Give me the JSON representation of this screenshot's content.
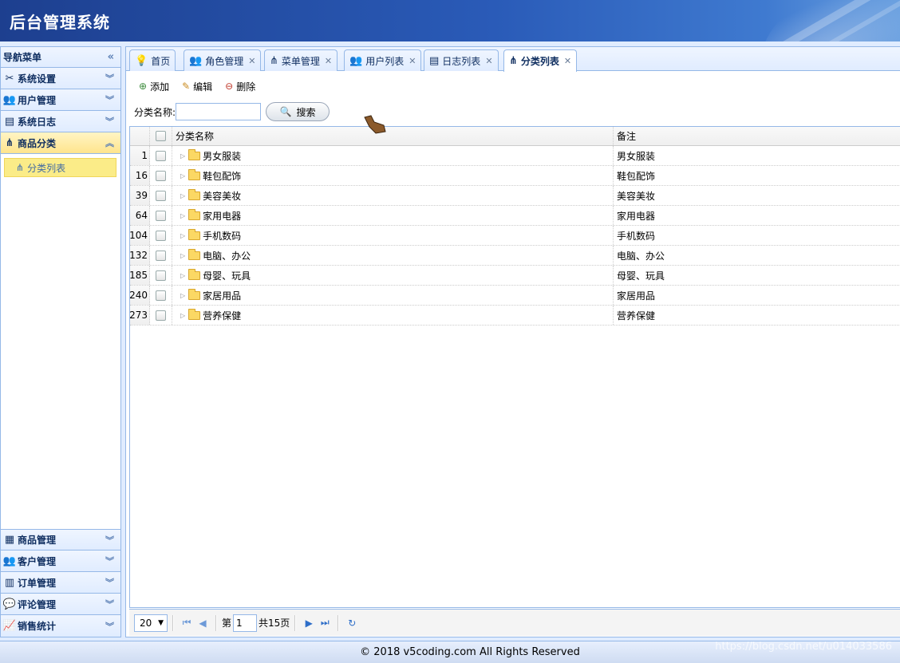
{
  "header": {
    "title": "后台管理系统"
  },
  "sidebar": {
    "head": "导航菜单",
    "top_sections": [
      {
        "label": "系统设置",
        "icon": "tools-icon"
      },
      {
        "label": "用户管理",
        "icon": "users-icon"
      },
      {
        "label": "系统日志",
        "icon": "log-icon"
      },
      {
        "label": "商品分类",
        "icon": "tree-icon"
      }
    ],
    "active_item": "分类列表",
    "bottom_sections": [
      {
        "label": "商品管理",
        "icon": "goods-icon"
      },
      {
        "label": "客户管理",
        "icon": "customers-icon"
      },
      {
        "label": "订单管理",
        "icon": "orders-icon"
      },
      {
        "label": "评论管理",
        "icon": "comment-icon"
      },
      {
        "label": "销售统计",
        "icon": "chart-icon"
      }
    ]
  },
  "tabs": [
    {
      "label": "首页",
      "closable": false
    },
    {
      "label": "角色管理",
      "closable": true
    },
    {
      "label": "菜单管理",
      "closable": true
    },
    {
      "label": "用户列表",
      "closable": true
    },
    {
      "label": "日志列表",
      "closable": true
    },
    {
      "label": "分类列表",
      "closable": true,
      "active": true
    }
  ],
  "toolbar": {
    "add": "添加",
    "edit": "编辑",
    "delete": "删除"
  },
  "search": {
    "label": "分类名称:",
    "value": "",
    "button": "搜索"
  },
  "grid": {
    "headers": {
      "name": "分类名称",
      "remark": "备注"
    },
    "rows": [
      {
        "num": "1",
        "name": "男女服装",
        "remark": "男女服装"
      },
      {
        "num": "16",
        "name": "鞋包配饰",
        "remark": "鞋包配饰"
      },
      {
        "num": "39",
        "name": "美容美妆",
        "remark": "美容美妆"
      },
      {
        "num": "64",
        "name": "家用电器",
        "remark": "家用电器"
      },
      {
        "num": "104",
        "name": "手机数码",
        "remark": "手机数码"
      },
      {
        "num": "132",
        "name": "电脑、办公",
        "remark": "电脑、办公"
      },
      {
        "num": "185",
        "name": "母婴、玩具",
        "remark": "母婴、玩具"
      },
      {
        "num": "240",
        "name": "家居用品",
        "remark": "家居用品"
      },
      {
        "num": "273",
        "name": "营养保健",
        "remark": "营养保健"
      }
    ]
  },
  "pager": {
    "page_size": "20",
    "page_prefix": "第",
    "page": "1",
    "total": "共15页"
  },
  "footer": {
    "text": "© 2018 v5coding.com All Rights Reserved",
    "watermark": "https://blog.csdn.net/u014033586"
  }
}
